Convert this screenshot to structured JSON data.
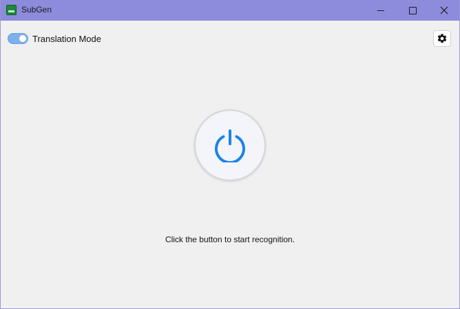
{
  "window": {
    "title": "SubGen",
    "app_icon": "subtitle-app-icon",
    "controls": {
      "minimize_icon": "minimize-icon",
      "maximize_icon": "maximize-icon",
      "close_icon": "close-icon"
    },
    "titlebar_color": "#8d8bdb"
  },
  "toolbar": {
    "translation_toggle": {
      "label": "Translation Mode",
      "on": true,
      "color": "#7fb0ec"
    },
    "settings_icon": "gear-icon"
  },
  "main": {
    "power_button": {
      "icon": "power-icon",
      "icon_color": "#1a84e8"
    },
    "status_text": "Click the button to start recognition."
  }
}
